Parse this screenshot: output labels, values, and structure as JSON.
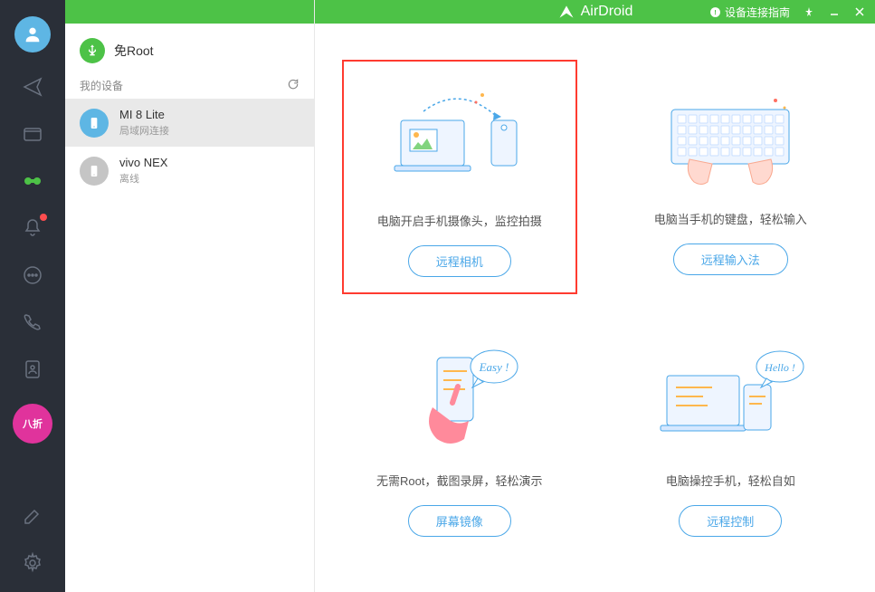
{
  "brand": "AirDroid",
  "titlebar": {
    "help_text": "设备连接指南"
  },
  "root": {
    "label": "免Root"
  },
  "sidebar": {
    "section_label": "我的设备",
    "devices": [
      {
        "name": "MI 8 Lite",
        "status": "局域网连接",
        "online": true,
        "active": true
      },
      {
        "name": "vivo NEX",
        "status": "离线",
        "online": false,
        "active": false
      }
    ]
  },
  "nav": {
    "discount_label": "八折"
  },
  "features": [
    {
      "desc": "电脑开启手机摄像头，监控拍摄",
      "button": "远程相机",
      "highlighted": true
    },
    {
      "desc": "电脑当手机的键盘，轻松输入",
      "button": "远程输入法",
      "highlighted": false
    },
    {
      "desc": "无需Root，截图录屏，轻松演示",
      "button": "屏幕镜像",
      "highlighted": false
    },
    {
      "desc": "电脑操控手机，轻松自如",
      "button": "远程控制",
      "highlighted": false
    }
  ]
}
